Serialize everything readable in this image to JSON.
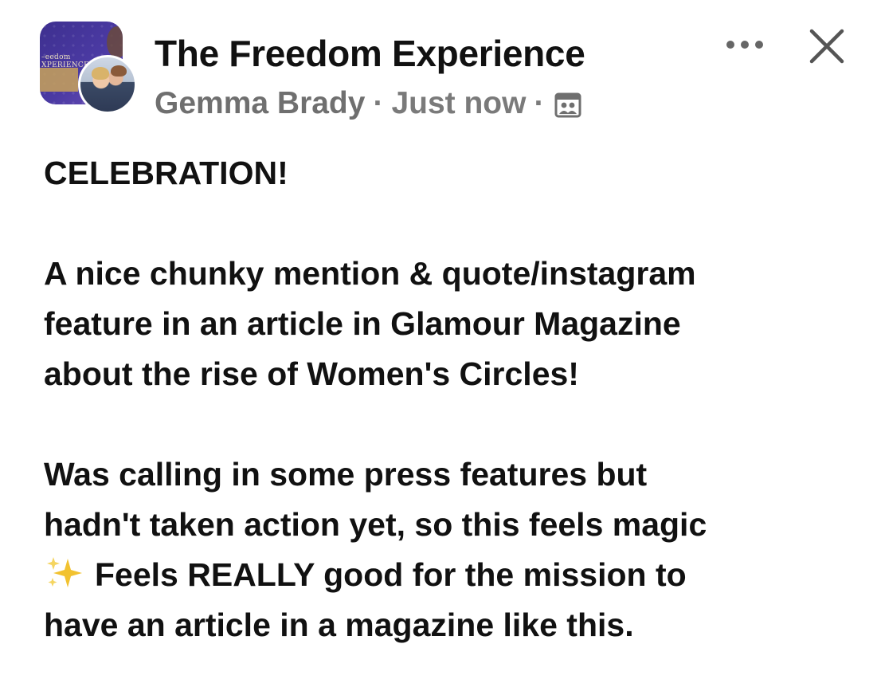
{
  "post": {
    "group_name": "The Freedom Experience",
    "author": "Gemma Brady",
    "separator": "·",
    "timestamp": "Just now",
    "group_avatar_text": "edom\nXPERIENCE",
    "more_icon": "more-horizontal-icon",
    "close_icon": "close-icon",
    "audience_icon": "group-audience-icon",
    "emoji": "sparkles",
    "colors": {
      "text": "#111111",
      "meta": "#7a7a7a",
      "avatar_bg": "#4b3aa3",
      "sparkle": "#f2c230"
    },
    "body": {
      "line1": "CELEBRATION!",
      "line2": "A nice chunky mention & quote/instagram",
      "line3": "feature in an article in Glamour Magazine",
      "line4": "about the rise of Women's Circles!",
      "line5": "Was calling in some press features but",
      "line6": "hadn't taken action yet, so this feels magic",
      "line7": "Feels REALLY good for the mission to",
      "line8": "have an article in a magazine like this."
    }
  }
}
